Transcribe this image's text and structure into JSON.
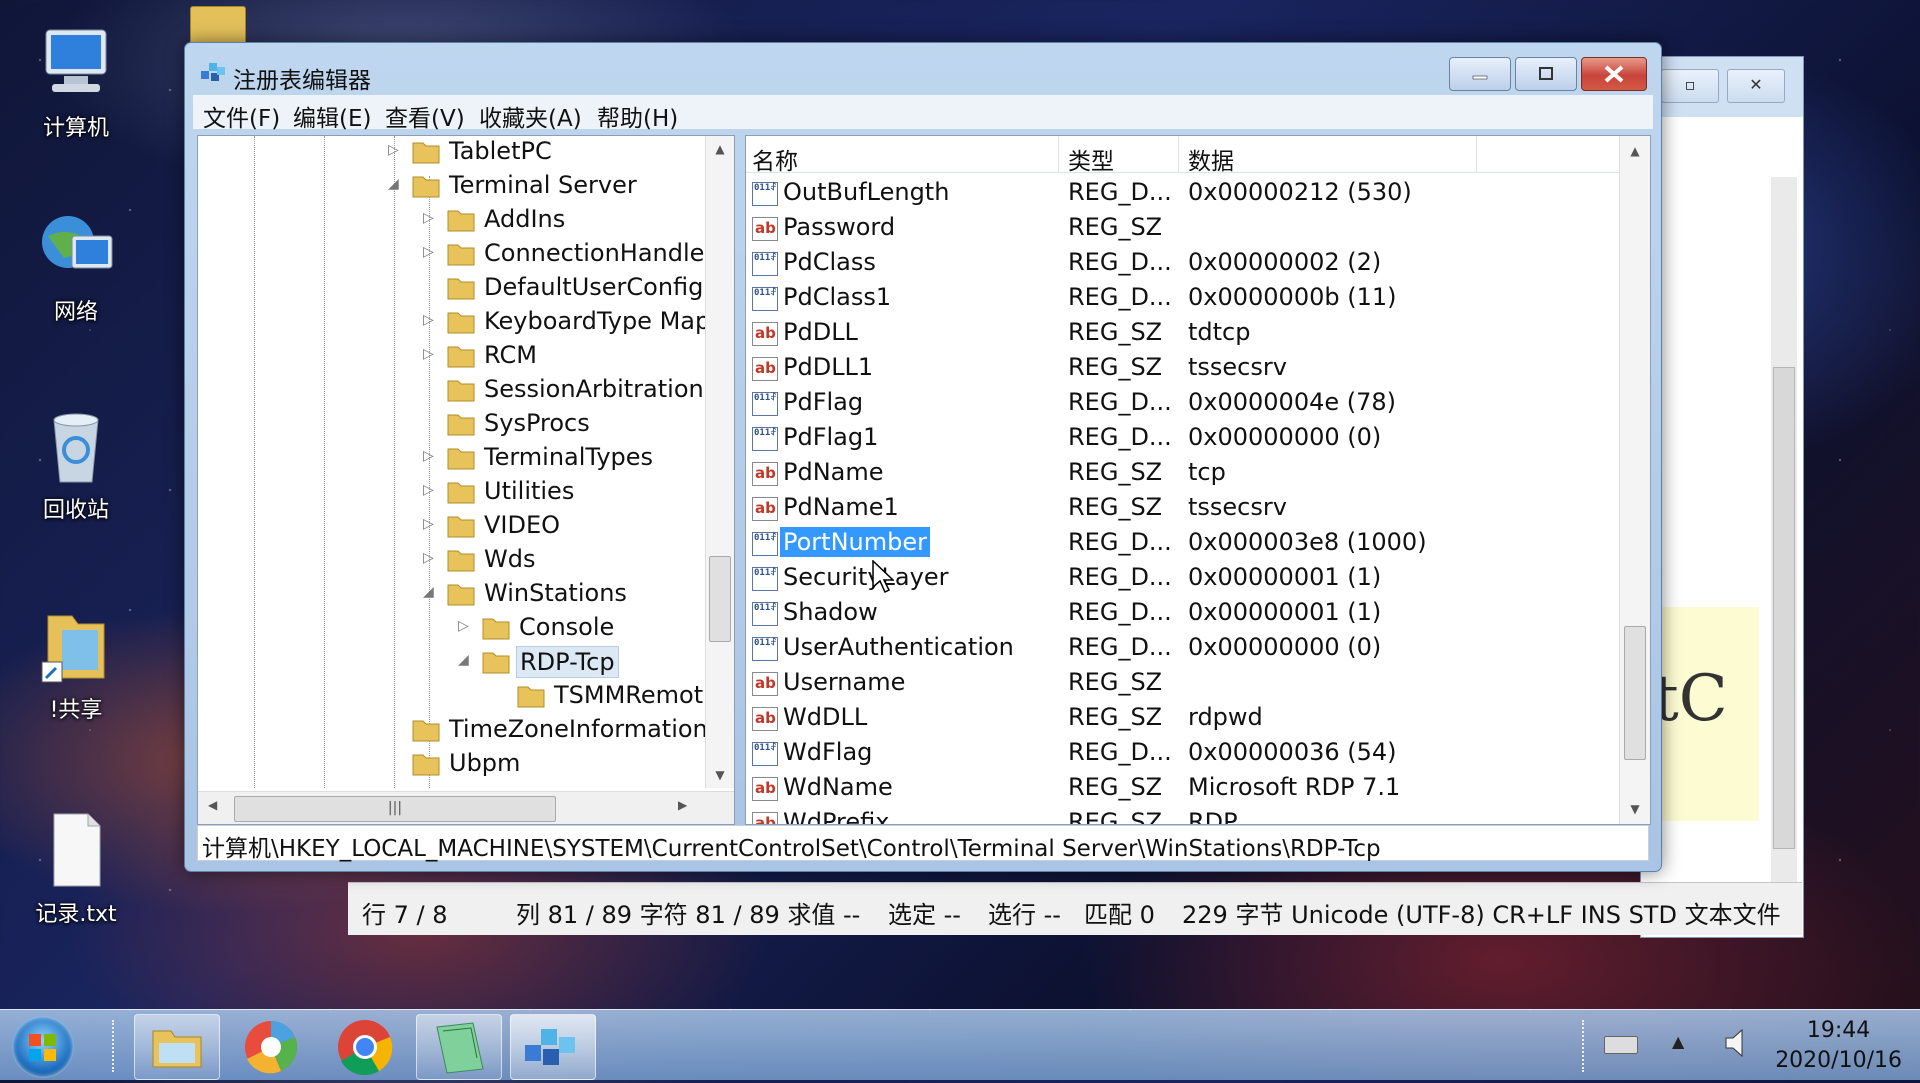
{
  "desktop_icons": [
    {
      "label": "计算机",
      "icon": "computer-icon"
    },
    {
      "label": "网络",
      "icon": "network-icon"
    },
    {
      "label": "回收站",
      "icon": "recycle-bin-icon"
    },
    {
      "label": "!共享",
      "icon": "shared-folder-icon"
    },
    {
      "label": "记录.txt",
      "icon": "text-file-icon"
    }
  ],
  "regedit": {
    "title": "注册表编辑器",
    "menu": [
      "文件(F)",
      "编辑(E)",
      "查看(V)",
      "收藏夹(A)",
      "帮助(H)"
    ],
    "tree": [
      {
        "label": "TabletPC"
      },
      {
        "label": "Terminal Server"
      },
      {
        "label": "AddIns"
      },
      {
        "label": "ConnectionHandler"
      },
      {
        "label": "DefaultUserConfigu"
      },
      {
        "label": "KeyboardType Map"
      },
      {
        "label": "RCM"
      },
      {
        "label": "SessionArbitrationH"
      },
      {
        "label": "SysProcs"
      },
      {
        "label": "TerminalTypes"
      },
      {
        "label": "Utilities"
      },
      {
        "label": "VIDEO"
      },
      {
        "label": "Wds"
      },
      {
        "label": "WinStations"
      },
      {
        "label": "Console"
      },
      {
        "label": "RDP-Tcp",
        "selected": true
      },
      {
        "label": "TSMMRemot"
      },
      {
        "label": "TimeZoneInformation"
      },
      {
        "label": "Ubpm"
      }
    ],
    "columns": {
      "name": "名称",
      "type": "类型",
      "data": "数据"
    },
    "values": [
      {
        "name": "OutBufLength",
        "type": "REG_D...",
        "data": "0x00000212 (530)",
        "kind": "bin"
      },
      {
        "name": "Password",
        "type": "REG_SZ",
        "data": "",
        "kind": "ab"
      },
      {
        "name": "PdClass",
        "type": "REG_D...",
        "data": "0x00000002 (2)",
        "kind": "bin"
      },
      {
        "name": "PdClass1",
        "type": "REG_D...",
        "data": "0x0000000b (11)",
        "kind": "bin"
      },
      {
        "name": "PdDLL",
        "type": "REG_SZ",
        "data": "tdtcp",
        "kind": "ab"
      },
      {
        "name": "PdDLL1",
        "type": "REG_SZ",
        "data": "tssecsrv",
        "kind": "ab"
      },
      {
        "name": "PdFlag",
        "type": "REG_D...",
        "data": "0x0000004e (78)",
        "kind": "bin"
      },
      {
        "name": "PdFlag1",
        "type": "REG_D...",
        "data": "0x00000000 (0)",
        "kind": "bin"
      },
      {
        "name": "PdName",
        "type": "REG_SZ",
        "data": "tcp",
        "kind": "ab"
      },
      {
        "name": "PdName1",
        "type": "REG_SZ",
        "data": "tssecsrv",
        "kind": "ab"
      },
      {
        "name": "PortNumber",
        "type": "REG_D...",
        "data": "0x000003e8 (1000)",
        "kind": "bin",
        "selected": true
      },
      {
        "name": "SecurityLayer",
        "type": "REG_D...",
        "data": "0x00000001 (1)",
        "kind": "bin"
      },
      {
        "name": "Shadow",
        "type": "REG_D...",
        "data": "0x00000001 (1)",
        "kind": "bin"
      },
      {
        "name": "UserAuthentication",
        "type": "REG_D...",
        "data": "0x00000000 (0)",
        "kind": "bin"
      },
      {
        "name": "Username",
        "type": "REG_SZ",
        "data": "",
        "kind": "ab"
      },
      {
        "name": "WdDLL",
        "type": "REG_SZ",
        "data": "rdpwd",
        "kind": "ab"
      },
      {
        "name": "WdFlag",
        "type": "REG_D...",
        "data": "0x00000036 (54)",
        "kind": "bin"
      },
      {
        "name": "WdName",
        "type": "REG_SZ",
        "data": "Microsoft RDP 7.1",
        "kind": "ab"
      },
      {
        "name": "WdPrefix",
        "type": "REG_SZ",
        "data": "RDP",
        "kind": "ab"
      }
    ],
    "address": "计算机\\HKEY_LOCAL_MACHINE\\SYSTEM\\CurrentControlSet\\Control\\Terminal Server\\WinStations\\RDP-Tcp"
  },
  "editor": {
    "big_text": "tC",
    "status": {
      "line": "行  7 / 8",
      "col": "列  81 / 89  字符  81 / 89  求值  --",
      "sel": "选定  --",
      "selline": "选行  --",
      "match": "匹配  0",
      "info": "229 字节  Unicode (UTF-8)  CR+LF  INS  STD  文本文件"
    }
  },
  "taskbar": {
    "time": "19:44",
    "date": "2020/10/16",
    "apps": [
      "file-explorer-icon",
      "color-picker-app-icon",
      "chrome-icon",
      "notepad-app-icon",
      "regedit-icon"
    ]
  }
}
